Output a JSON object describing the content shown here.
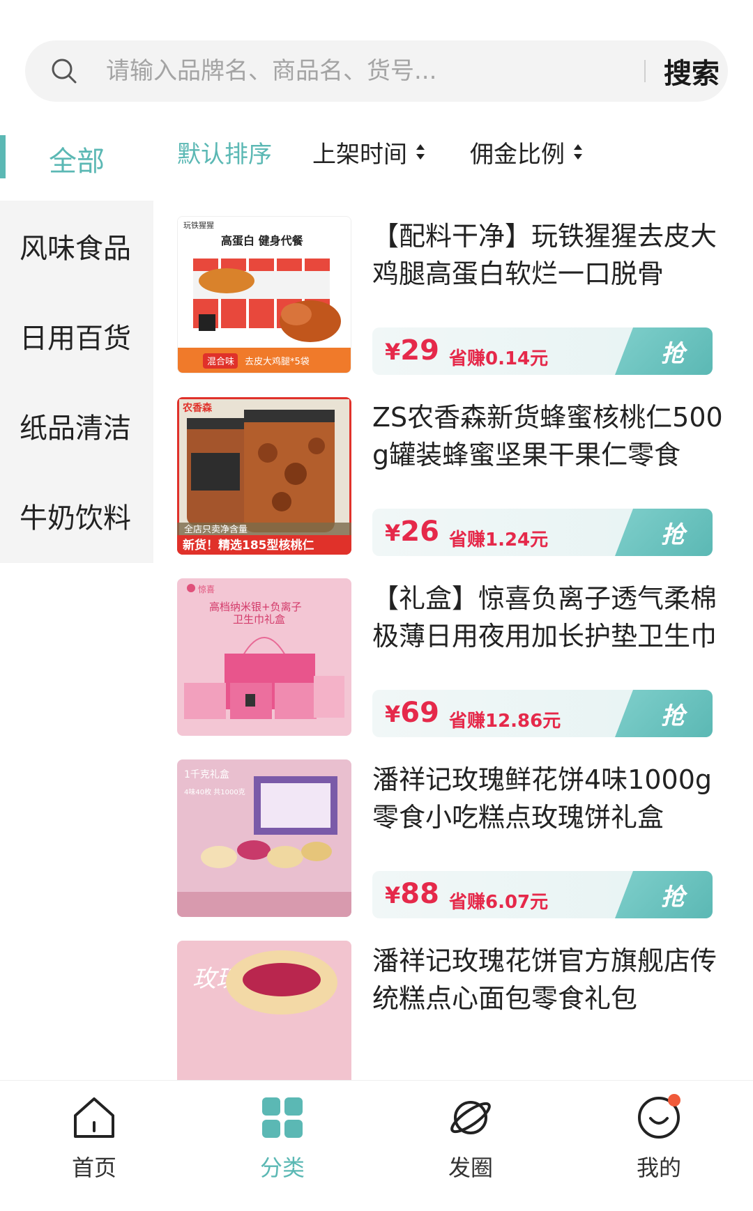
{
  "search": {
    "placeholder": "请输入品牌名、商品名、货号...",
    "button_label": "搜索"
  },
  "sidebar": {
    "all_label": "全部",
    "categories": [
      "风味食品",
      "日用百货",
      "纸品清洁",
      "牛奶饮料"
    ]
  },
  "sort": {
    "default_label": "默认排序",
    "time_label": "上架时间",
    "commission_label": "佣金比例"
  },
  "products": [
    {
      "title": "【配料干净】玩铁猩猩去皮大鸡腿高蛋白软烂一口脱骨",
      "price": "29",
      "save": "省赚0.14元",
      "grab": "抢",
      "thumb_top": "玩铁猩猩",
      "thumb_sub": "高蛋白 健身代餐",
      "thumb_tag": "混合味",
      "thumb_foot": "去皮大鸡腿*5袋"
    },
    {
      "title": "ZS农香森新货蜂蜜核桃仁500g罐装蜂蜜坚果干果仁零食",
      "price": "26",
      "save": "省赚1.24元",
      "grab": "抢",
      "thumb_top": "农香森",
      "thumb_mid": "全店只卖净含量",
      "thumb_foot": "新货！精选185型核桃仁"
    },
    {
      "title": "【礼盒】惊喜负离子透气柔棉极薄日用夜用加长护垫卫生巾",
      "price": "69",
      "save": "省赚12.86元",
      "grab": "抢",
      "thumb_top": "惊喜",
      "thumb_line1": "高档纳米银+负离子",
      "thumb_line2": "卫生巾礼盒"
    },
    {
      "title": "潘祥记玫瑰鲜花饼4味1000g零食小吃糕点玫瑰饼礼盒",
      "price": "88",
      "save": "省赚6.07元",
      "grab": "抢",
      "thumb_top": "1千克礼盒",
      "thumb_sub": "4味40枚 共1000克"
    },
    {
      "title": "潘祥记玫瑰花饼官方旗舰店传统糕点心面包零食礼包",
      "thumb_top": "玫瑰"
    }
  ],
  "bottom_nav": [
    {
      "label": "首页"
    },
    {
      "label": "分类"
    },
    {
      "label": "发圈"
    },
    {
      "label": "我的"
    }
  ],
  "colors": {
    "accent": "#5bb8b4",
    "price": "#e5294a",
    "sidebar_bg": "#f4f4f4",
    "badge": "#f05a3a"
  }
}
